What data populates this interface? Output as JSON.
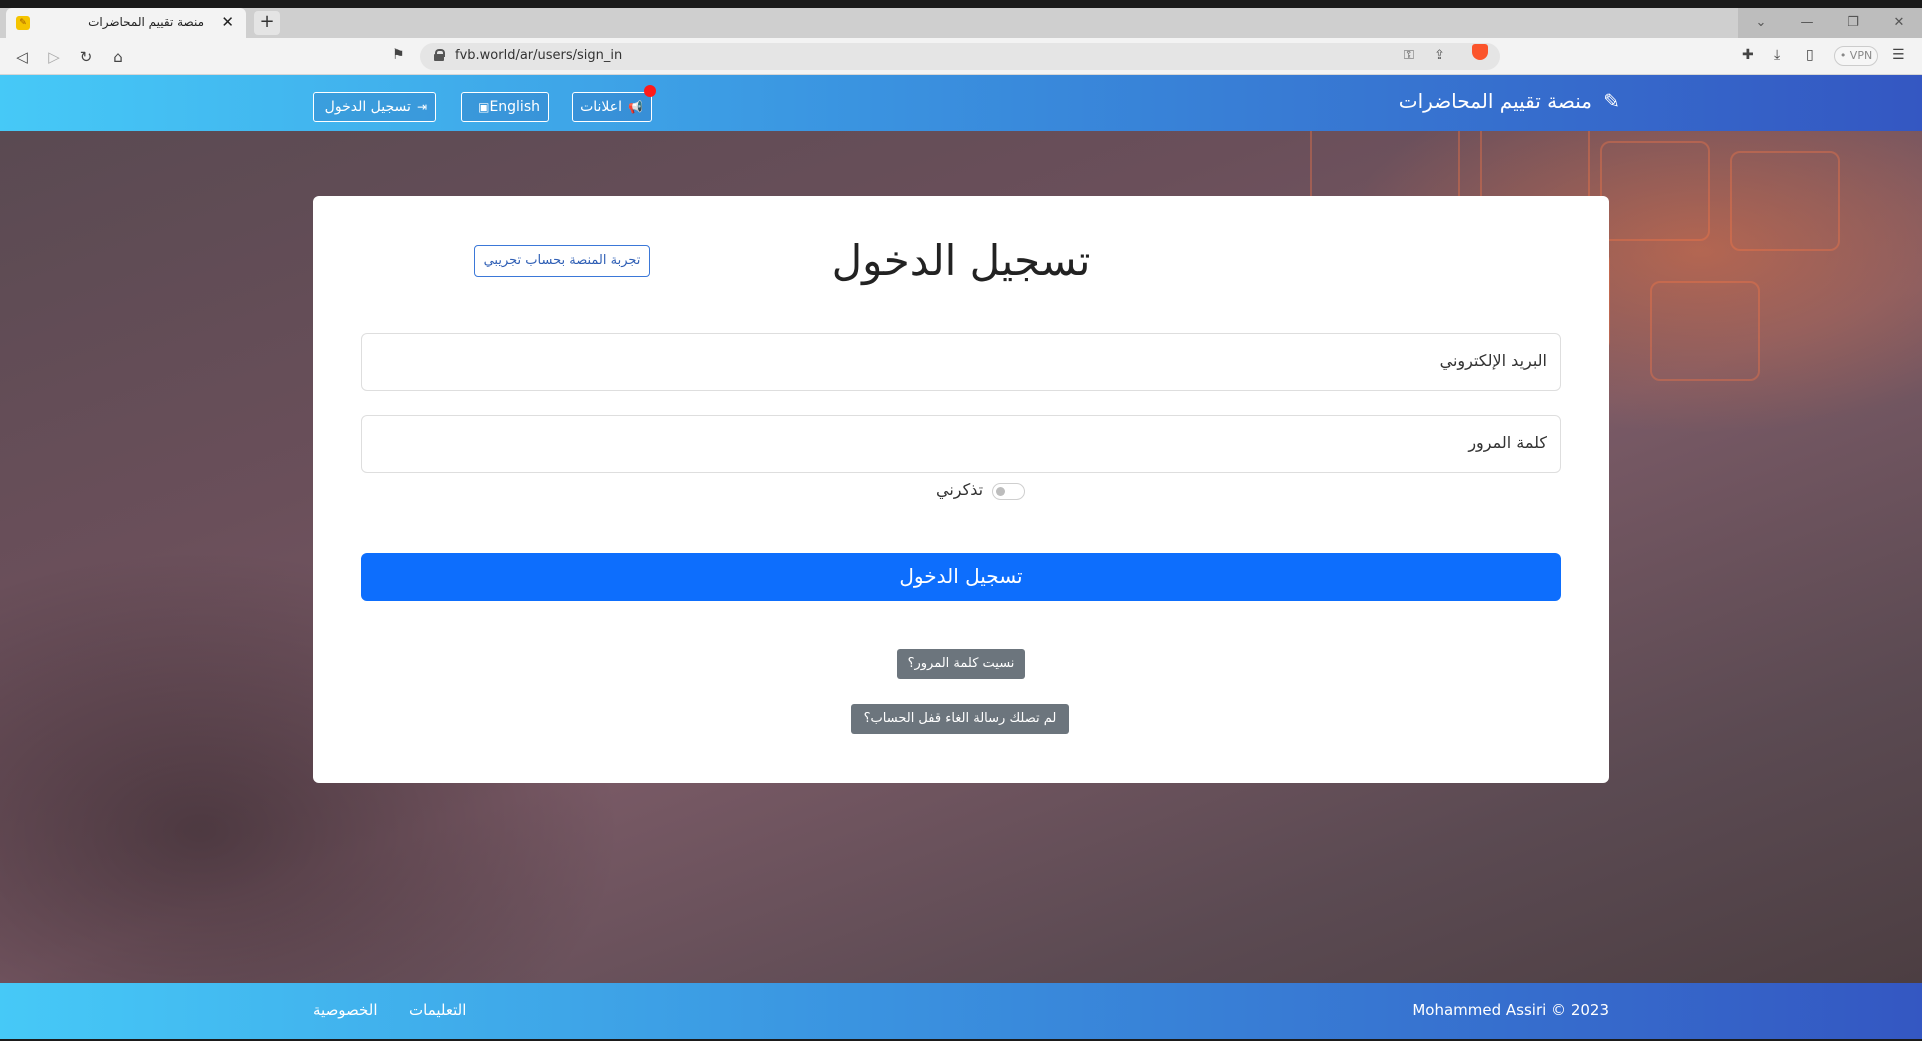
{
  "browser": {
    "tab_title": "منصة تقييم المحاضرات",
    "tab_close": "✕",
    "new_tab": "+",
    "url": "fvb.world/ar/users/sign_in",
    "vpn_label": "• VPN",
    "icons": [
      "back-icon",
      "forward-icon",
      "reload-icon",
      "home-icon",
      "bookmark-icon",
      "lock-icon",
      "key-icon",
      "share-icon",
      "brave-shield-icon",
      "extensions-icon",
      "download-icon",
      "sidebar-icon",
      "menu-icon"
    ]
  },
  "navbar": {
    "brand": "منصة تقييم المحاضرات",
    "announcements": "اعلانات",
    "language": "English",
    "login": "تسجيل الدخول"
  },
  "form": {
    "title": "تسجيل الدخول",
    "demo_button": "تجربة المنصة بحساب تجريبي",
    "email_label": "البريد الإلكتروني",
    "password_label": "كلمة المرور",
    "remember_label": "تذكرني",
    "remember_checked": false,
    "submit": "تسجيل الدخول",
    "forgot_password": "نسيت كلمة المرور؟",
    "unlock_instructions": "لم تصلك رسالة الغاء قفل الحساب؟"
  },
  "footer": {
    "copyright": "Mohammed Assiri © 2023",
    "instructions": "التعليمات",
    "privacy": "الخصوصية"
  },
  "colors": {
    "primary": "#0d6efd",
    "secondary": "#6c757d",
    "gradient_start": "#46c9f7",
    "gradient_end": "#3457c2"
  }
}
